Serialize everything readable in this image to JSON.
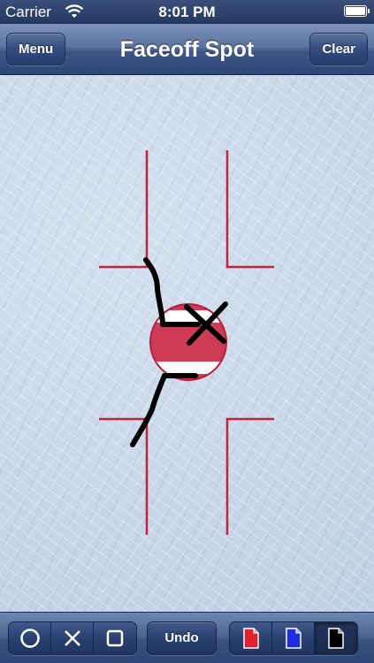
{
  "status_bar": {
    "carrier": "Carrier",
    "time": "8:01 PM",
    "wifi_icon": "wifi-icon",
    "battery_icon": "battery-icon"
  },
  "nav_bar": {
    "title": "Faceoff Spot",
    "left_button": "Menu",
    "right_button": "Clear"
  },
  "canvas": {
    "background": "ice-texture",
    "rink_line_color": "#c0243f",
    "faceoff_dot_color": "#cf3a55",
    "ink_color": "#000000"
  },
  "toolbar": {
    "shape_tools": [
      {
        "icon": "circle-tool-icon",
        "selected": false
      },
      {
        "icon": "x-tool-icon",
        "selected": false
      },
      {
        "icon": "square-tool-icon",
        "selected": false
      }
    ],
    "undo_label": "Undo",
    "color_tools": [
      {
        "icon": "red-pen-icon",
        "color": "#e0202a",
        "selected": false
      },
      {
        "icon": "blue-pen-icon",
        "color": "#1c2fe0",
        "selected": false
      },
      {
        "icon": "black-pen-icon",
        "color": "#000000",
        "selected": true
      }
    ]
  }
}
